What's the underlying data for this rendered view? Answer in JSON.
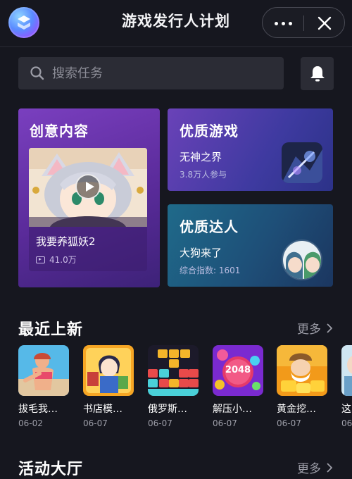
{
  "header": {
    "title": "游戏发行人计划",
    "logo_icon": "app-logo-icon",
    "more_icon": "more-dots-icon",
    "close_icon": "close-icon"
  },
  "search": {
    "placeholder": "搜索任务",
    "value": ""
  },
  "notification": {
    "icon": "bell-icon"
  },
  "feature_cards": {
    "creative": {
      "title": "创意内容",
      "video_title": "我要养狐妖2",
      "video_views": "41.0万"
    },
    "quality_games": {
      "title": "优质游戏",
      "game_name": "无神之界",
      "participants": "3.8万人参与"
    },
    "quality_talent": {
      "title": "优质达人",
      "talent_name": "大狗来了",
      "index_text": "综合指数: 1601"
    }
  },
  "recent": {
    "title": "最近上新",
    "more": "更多",
    "games": [
      {
        "name": "拔毛我…",
        "date": "06-02"
      },
      {
        "name": "书店模…",
        "date": "06-07"
      },
      {
        "name": "俄罗斯…",
        "date": "06-07"
      },
      {
        "name": "解压小…",
        "date": "06-07"
      },
      {
        "name": "黄金挖…",
        "date": "06-07"
      },
      {
        "name": "这",
        "date": "06"
      }
    ]
  },
  "events": {
    "title": "活动大厅",
    "more": "更多"
  },
  "colors": {
    "background": "#16171f",
    "creative_card": "#6a36b0",
    "games_card": "#4a3eaa",
    "talent_card": "#1e4f78"
  }
}
